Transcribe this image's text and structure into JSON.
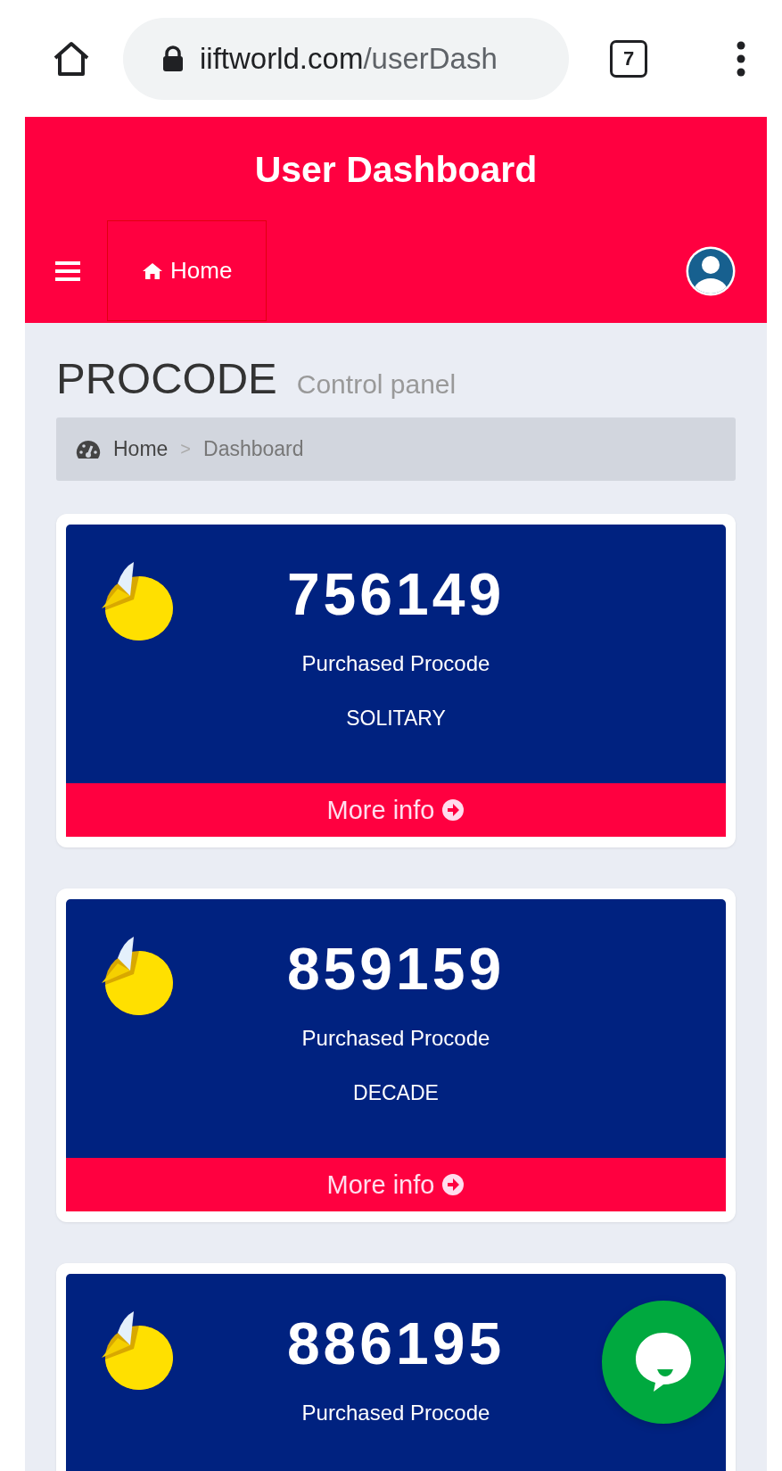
{
  "browser": {
    "url_host": "iiftworld.com",
    "url_path": "/userDash",
    "tab_count": "7"
  },
  "header": {
    "title": "User Dashboard",
    "nav": [
      {
        "label": "Home"
      }
    ]
  },
  "page": {
    "title": "PROCODE",
    "subtitle": "Control panel"
  },
  "breadcrumb": [
    {
      "label": "Home"
    },
    {
      "label": "Dashboard"
    }
  ],
  "breadcrumb_separator": ">",
  "cards": [
    {
      "value": "756149",
      "label": "Purchased Procode",
      "sublabel": "SOLITARY",
      "link": "More info"
    },
    {
      "value": "859159",
      "label": "Purchased Procode",
      "sublabel": "DECADE",
      "link": "More info"
    },
    {
      "value": "886195",
      "label": "Purchased Procode"
    }
  ]
}
